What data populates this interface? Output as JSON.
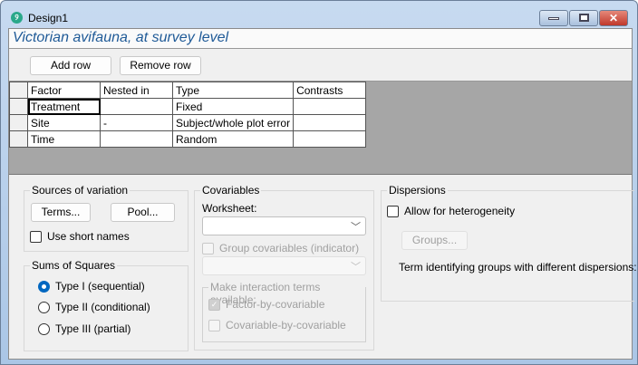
{
  "window": {
    "title": "Design1"
  },
  "subtitle": "Victorian avifauna, at survey level",
  "toolbar": {
    "add_row": "Add row",
    "remove_row": "Remove row"
  },
  "table": {
    "headers": [
      "Factor",
      "Nested in",
      "Type",
      "Contrasts"
    ],
    "rows": [
      [
        "Treatment",
        "",
        "Fixed",
        ""
      ],
      [
        "Site",
        "-",
        "Subject/whole plot error",
        ""
      ],
      [
        "Time",
        "",
        "Random",
        ""
      ]
    ]
  },
  "sources": {
    "title": "Sources of variation",
    "terms": "Terms...",
    "pool": "Pool...",
    "short_names": "Use short names"
  },
  "sums": {
    "title": "Sums of Squares",
    "options": [
      "Type I (sequential)",
      "Type II (conditional)",
      "Type III (partial)"
    ],
    "selected": 0
  },
  "covariables": {
    "title": "Covariables",
    "worksheet_label": "Worksheet:",
    "worksheet_value": "",
    "group_cov": "Group covariables (indicator)",
    "interaction_title": "Make interaction terms available:",
    "factor_by_cov": "Factor-by-covariable",
    "cov_by_cov": "Covariable-by-covariable"
  },
  "dispersions": {
    "title": "Dispersions",
    "allow": "Allow for heterogeneity",
    "groups": "Groups...",
    "term_label": "Term identifying groups with different dispersions:"
  }
}
